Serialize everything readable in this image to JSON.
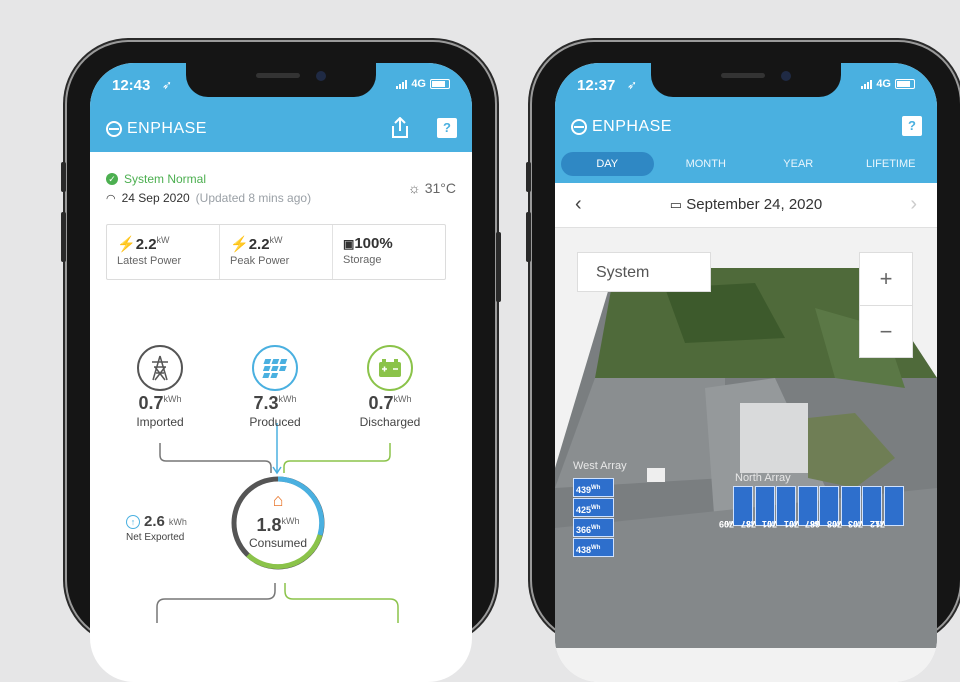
{
  "phone1": {
    "status": {
      "time": "12:43",
      "network": "4G"
    },
    "brand": "ENPHASE",
    "system_status": "System Normal",
    "date": "24 Sep 2020",
    "updated": "(Updated 8 mins ago)",
    "weather": "31°C",
    "stats": [
      {
        "value": "2.2",
        "unit": "kW",
        "label": "Latest Power"
      },
      {
        "value": "2.2",
        "unit": "kW",
        "label": "Peak Power"
      },
      {
        "value": "100%",
        "unit": "",
        "label": "Storage"
      }
    ],
    "flow": {
      "imported": {
        "value": "0.7",
        "unit": "kWh",
        "label": "Imported"
      },
      "produced": {
        "value": "7.3",
        "unit": "kWh",
        "label": "Produced"
      },
      "discharged": {
        "value": "0.7",
        "unit": "kWh",
        "label": "Discharged"
      },
      "consumed": {
        "value": "1.8",
        "unit": "kWh",
        "label": "Consumed"
      },
      "exported": {
        "value": "2.6",
        "unit": "kWh",
        "label": "Net Exported"
      }
    }
  },
  "phone2": {
    "status": {
      "time": "12:37",
      "network": "4G"
    },
    "brand": "ENPHASE",
    "tabs": [
      "DAY",
      "MONTH",
      "YEAR",
      "LIFETIME"
    ],
    "date": "September 24, 2020",
    "system_dropdown": "System",
    "zoom_in": "+",
    "zoom_out": "−",
    "west_array": {
      "label": "West Array",
      "values": [
        "439",
        "425",
        "366",
        "438"
      ],
      "unit": "Wh"
    },
    "north_array": {
      "label": "North Array",
      "values": [
        "709",
        "737",
        "701",
        "701",
        "687",
        "708",
        "703",
        "712"
      ],
      "unit": "Wh"
    }
  },
  "colors": {
    "brand_blue": "#4ab0e0",
    "green": "#8bc34a",
    "status_green": "#4caf50"
  }
}
